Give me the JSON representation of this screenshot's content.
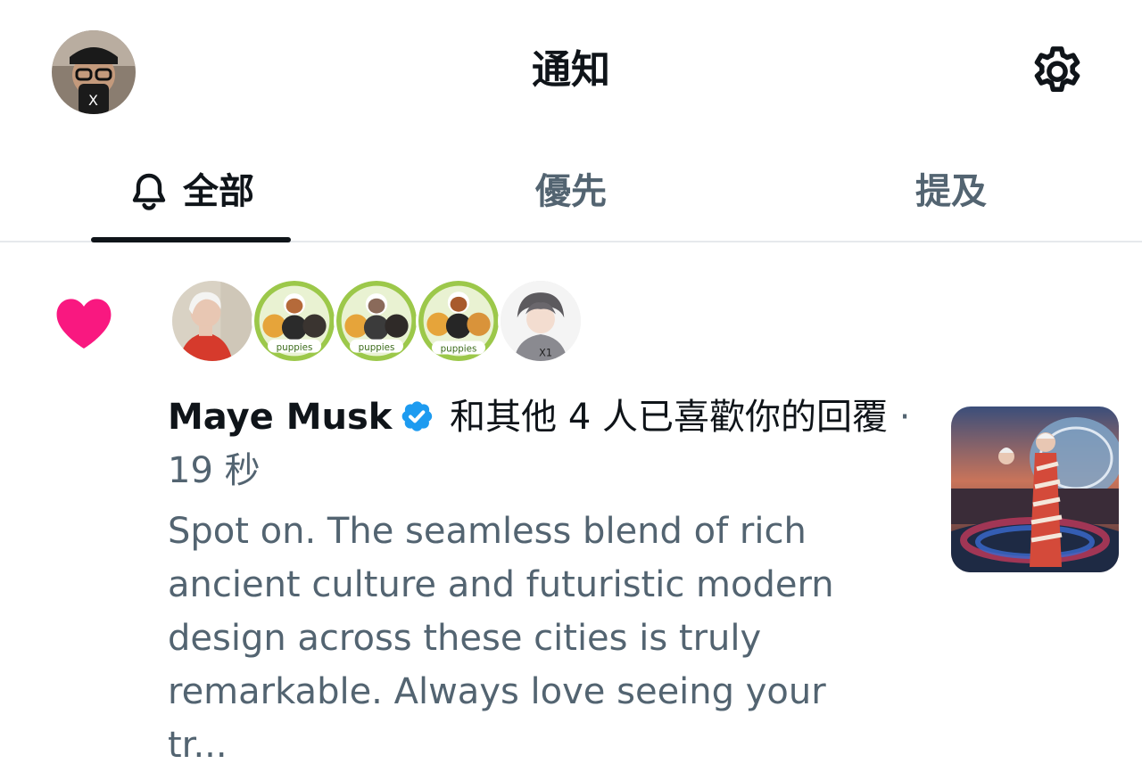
{
  "header": {
    "title": "通知",
    "avatar_icon": "profile-avatar",
    "settings_icon": "gear-icon"
  },
  "tabs": [
    {
      "label": "全部",
      "icon": "bell-icon",
      "selected": true
    },
    {
      "label": "優先",
      "selected": false
    },
    {
      "label": "提及",
      "selected": false
    }
  ],
  "notification": {
    "type_icon": "heart-icon",
    "type_color": "#f91880",
    "avatars": [
      {
        "name": "maye-musk-avatar"
      },
      {
        "name": "puppies-avatar"
      },
      {
        "name": "puppies-avatar"
      },
      {
        "name": "puppies-avatar"
      },
      {
        "name": "anime-avatar"
      }
    ],
    "user_name": "Maye Musk",
    "verified_color": "#1d9bf0",
    "action_text": " 和其他 4 人已喜歡你的回覆",
    "timestamp": " · 19 秒",
    "reply_preview": "Spot on. The seamless blend of rich ancient culture and futuristic modern design across these cities is truly remarkable. Always love seeing your tr..."
  },
  "colors": {
    "text_primary": "#0f1419",
    "text_secondary": "#536471",
    "divider": "#e6e9ec"
  }
}
